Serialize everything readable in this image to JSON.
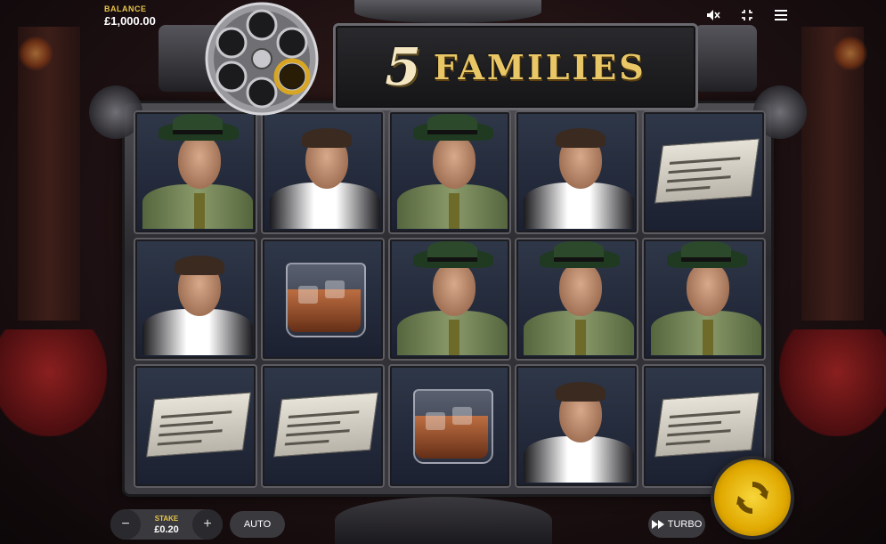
{
  "balance": {
    "label": "BALANCE",
    "value": "£1,000.00"
  },
  "hud": {
    "icons": [
      "mute-icon",
      "fullscreen-icon",
      "menu-icon"
    ]
  },
  "title": {
    "number": "5",
    "word": "FAMILIES"
  },
  "reels": [
    [
      "man-hat",
      "man-bare",
      "man-hat",
      "man-bare",
      "newspaper"
    ],
    [
      "man-bare",
      "whisky",
      "man-hat",
      "man-hat",
      "man-hat"
    ],
    [
      "newspaper",
      "newspaper",
      "whisky",
      "man-bare",
      "newspaper"
    ]
  ],
  "controls": {
    "stake_label": "STAKE",
    "stake_value": "£0.20",
    "minus": "−",
    "plus": "+",
    "auto": "AUTO",
    "turbo": "TURBO"
  },
  "colors": {
    "accent_gold": "#e6c44a",
    "spin_gold": "#f7d63a"
  }
}
